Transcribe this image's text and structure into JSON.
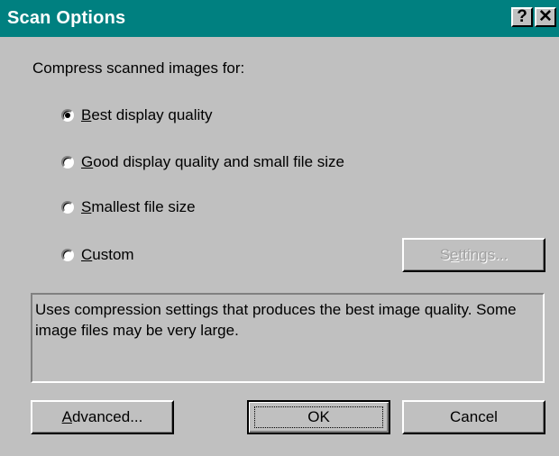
{
  "window": {
    "title": "Scan Options",
    "help_glyph": "?",
    "close_glyph": "✕"
  },
  "prompt": "Compress scanned images for:",
  "options": [
    {
      "mnemonic": "B",
      "rest": "est display quality",
      "checked": true
    },
    {
      "mnemonic": "G",
      "rest": "ood display quality and small file size",
      "checked": false
    },
    {
      "mnemonic": "S",
      "rest": "mallest file size",
      "checked": false
    },
    {
      "mnemonic": "C",
      "rest": "ustom",
      "checked": false
    }
  ],
  "settings_button": {
    "pre": "S",
    "mnemonic": "e",
    "rest": "ttings...",
    "enabled": false
  },
  "description": "Uses compression settings that produces the best image quality. Some image files may be very large.",
  "buttons": {
    "advanced": {
      "mnemonic": "A",
      "rest": "dvanced..."
    },
    "ok": "OK",
    "cancel": "Cancel"
  },
  "colors": {
    "titlebar": "#008080",
    "face": "#c0c0c0"
  }
}
